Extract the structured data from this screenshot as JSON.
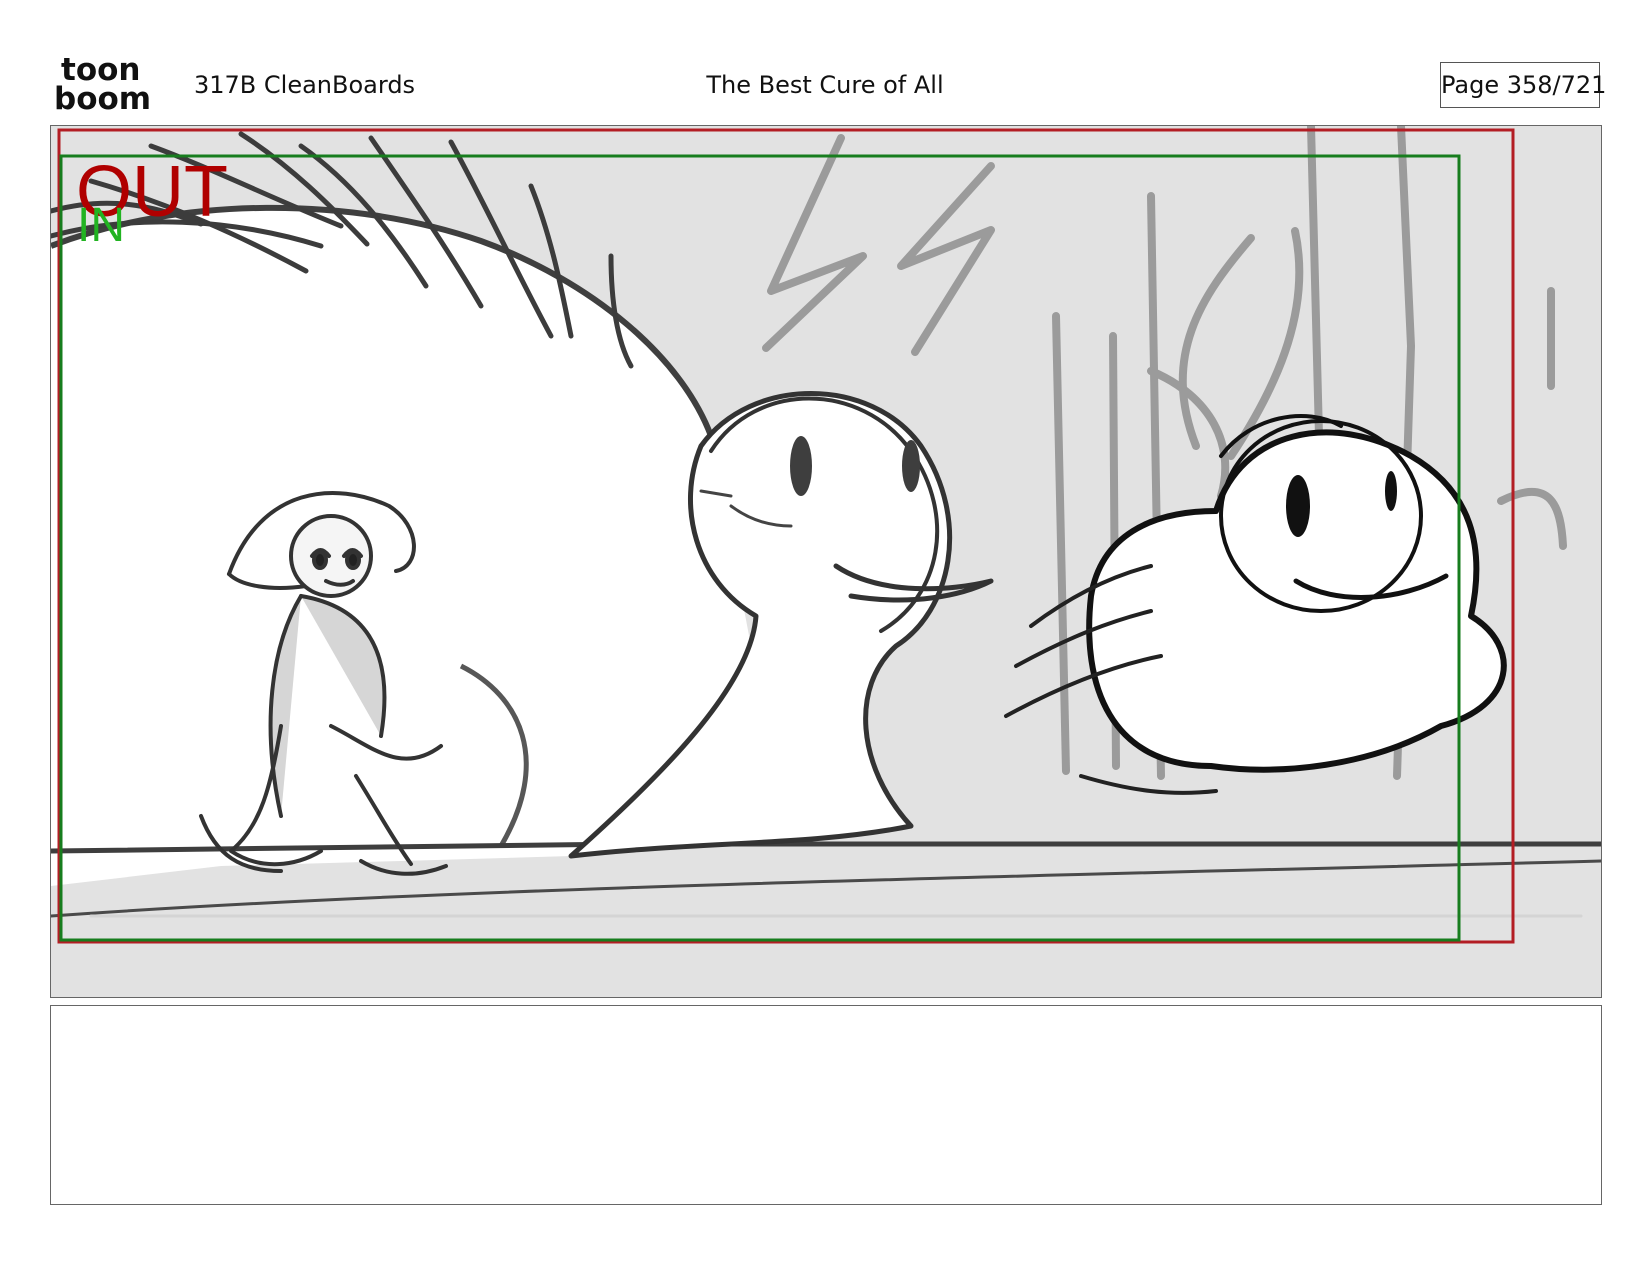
{
  "header": {
    "logo_top": "toon",
    "logo_bottom": "boom",
    "production": "317B  CleanBoards",
    "episode_title": "The Best Cure of All",
    "page_counter": "Page 358/721"
  },
  "panel": {
    "out_marker": "OUT",
    "in_marker": "IN",
    "icon": "storyboard-sketch-icon"
  },
  "notes": {
    "text": ""
  },
  "colors": {
    "frame": "#666666",
    "safe_area_red": "#b31d24",
    "safe_area_green": "#177d1e",
    "out_red": "#b00000",
    "in_green": "#21b321",
    "background_sketch": "#e2e2e2"
  }
}
